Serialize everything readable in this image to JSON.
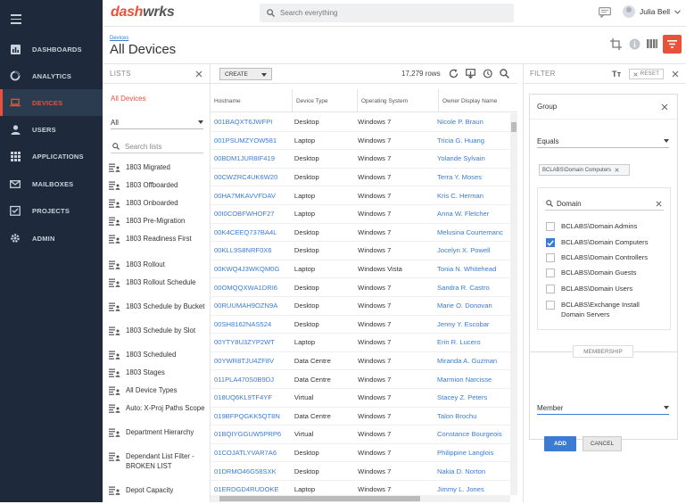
{
  "app": {
    "logo_a": "dash",
    "logo_b": "w",
    "logo_c": "rks"
  },
  "search": {
    "placeholder": "Search everything"
  },
  "user": {
    "name": "Julia Bell"
  },
  "nav": [
    {
      "label": "DASHBOARDS",
      "icon": "dashboard-icon"
    },
    {
      "label": "ANALYTICS",
      "icon": "analytics-icon"
    },
    {
      "label": "DEVICES",
      "icon": "laptop-icon"
    },
    {
      "label": "USERS",
      "icon": "user-icon"
    },
    {
      "label": "APPLICATIONS",
      "icon": "grid-icon"
    },
    {
      "label": "MAILBOXES",
      "icon": "mail-icon"
    },
    {
      "label": "PROJECTS",
      "icon": "project-icon"
    },
    {
      "label": "ADMIN",
      "icon": "gear-icon"
    }
  ],
  "header": {
    "breadcrumb": "Devices",
    "title": "All Devices"
  },
  "lists": {
    "title": "LISTS",
    "active": "All Devices",
    "filter_value": "All",
    "search_placeholder": "Search lists",
    "items": [
      "1803 Migrated",
      "1803 Offboarded",
      "1803 Onboarded",
      "1803 Pre-Migration",
      "1803 Readiness First",
      "1803 Rollout",
      "1803 Rollout Schedule",
      "1803 Schedule by Bucket",
      "1803 Schedule by Slot",
      "1803 Scheduled",
      "1803 Stages",
      "All Device Types",
      "Auto: X-Proj Paths Scope",
      "Department Hierarchy",
      "Dependant List Filter - BROKEN LIST",
      "Depot Capacity"
    ]
  },
  "grid": {
    "create_label": "CREATE",
    "row_count": "17,279 rows",
    "columns": [
      "Hostname",
      "Device Type",
      "Operating System",
      "Owner Display Name"
    ],
    "rows": [
      [
        "001BAQXT6JWFPI",
        "Desktop",
        "Windows 7",
        "Nicole P. Braun"
      ],
      [
        "001PSUMZYOW581",
        "Laptop",
        "Windows 7",
        "Tricia G. Huang"
      ],
      [
        "00BDM1JUR8IF419",
        "Desktop",
        "Windows 7",
        "Yolande Sylvain"
      ],
      [
        "00CWZRC4UK6W20",
        "Desktop",
        "Windows 7",
        "Terra Y. Moses"
      ],
      [
        "00HA7MKAVVFDAV",
        "Laptop",
        "Windows 7",
        "Kris C. Herman"
      ],
      [
        "00I0COBFWHOF27",
        "Laptop",
        "Windows 7",
        "Anna W. Fletcher"
      ],
      [
        "00K4CEEQ737BA4L",
        "Desktop",
        "Windows 7",
        "Melusina Courtemanc"
      ],
      [
        "00KLL9S8NRF0X6",
        "Desktop",
        "Windows 7",
        "Jocelyn X. Powell"
      ],
      [
        "00KWQ4J3WKQM0G",
        "Laptop",
        "Windows Vista",
        "Tonia N. Whitehead"
      ],
      [
        "00OMQQXWA1DRI6",
        "Desktop",
        "Windows 7",
        "Sandra R. Castro"
      ],
      [
        "00RUUMAH9OZN9A",
        "Desktop",
        "Windows 7",
        "Marie O. Donovan"
      ],
      [
        "00SH8162NAS524",
        "Desktop",
        "Windows 7",
        "Jenny Y. Escobar"
      ],
      [
        "00YTY8U3ZYP2WT",
        "Laptop",
        "Windows 7",
        "Erin R. Lucero"
      ],
      [
        "00YWR8TJU4ZF8V",
        "Data Centre",
        "Windows 7",
        "Miranda A. Guzman"
      ],
      [
        "011PLA470S0B9DJ",
        "Data Centre",
        "Windows 7",
        "Marmion Narcisse"
      ],
      [
        "018UQ6KL9TF4YF",
        "Virtual",
        "Windows 7",
        "Stacey Z. Peters"
      ],
      [
        "019BFPQGKK5QT8N",
        "Data Centre",
        "Windows 7",
        "Talon Brochu"
      ],
      [
        "01BQIYGGUW5PRP6",
        "Virtual",
        "Windows 7",
        "Constance Bourgeois"
      ],
      [
        "01COJATLYVAR7A6",
        "Desktop",
        "Windows 7",
        "Philippine Langlois"
      ],
      [
        "01DRMO46G58SXK",
        "Desktop",
        "Windows 7",
        "Nakia D. Norton"
      ],
      [
        "01ERDGD4RUDOKE",
        "Laptop",
        "Windows 7",
        "Jimmy L. Jones"
      ]
    ]
  },
  "filter": {
    "title": "FILTER",
    "reset_label": "RESET",
    "field": "Group",
    "operator": "Equals",
    "chip": "BCLABS\\Domain Computers",
    "search_value": "Domain",
    "options": [
      {
        "label": "BCLABS\\Domain Admins",
        "checked": false
      },
      {
        "label": "BCLABS\\Domain Computers",
        "checked": true
      },
      {
        "label": "BCLABS\\Domain Controllers",
        "checked": false
      },
      {
        "label": "BCLABS\\Domain Guests",
        "checked": false
      },
      {
        "label": "BCLABS\\Domain Users",
        "checked": false
      },
      {
        "label": "BCLABS\\Exchange Install Domain Servers",
        "checked": false
      }
    ],
    "membership_label": "MEMBERSHIP",
    "membership_value": "Member",
    "add_label": "ADD",
    "cancel_label": "CANCEL"
  },
  "colors": {
    "accent": "#e8513b",
    "link": "#3b7bd4",
    "sidebar": "#1e2a3b"
  }
}
